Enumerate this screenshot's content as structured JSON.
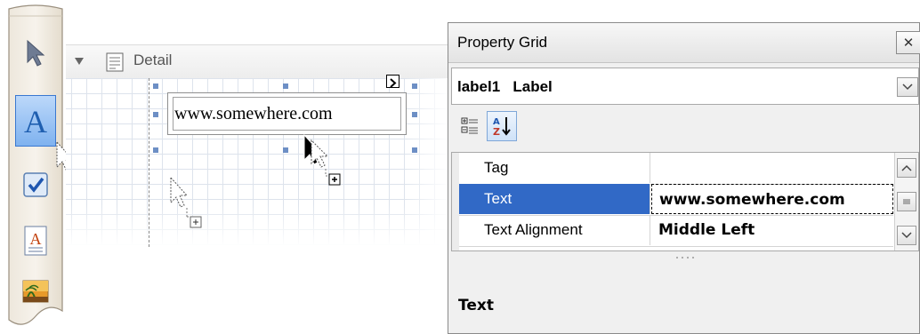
{
  "designer": {
    "band_title": "Detail",
    "label_text": "www.somewhere.com"
  },
  "toolbox": {
    "tools": [
      {
        "icon": "pointer-icon"
      },
      {
        "icon": "label-icon"
      },
      {
        "icon": "checkbox-icon"
      },
      {
        "icon": "rich-text-icon"
      },
      {
        "icon": "picture-box-icon"
      }
    ]
  },
  "property_grid": {
    "title": "Property Grid",
    "selected_object": "label1   Label",
    "toolbar": [
      "categorized-icon",
      "alphabetical-icon"
    ],
    "rows": [
      {
        "name": "Tag",
        "value": ""
      },
      {
        "name": "Text",
        "value": "www.somewhere.com"
      },
      {
        "name": "Text Alignment",
        "value": "Middle Left"
      }
    ],
    "description_title": "Text"
  },
  "colors": {
    "selection": "#3169c6",
    "handle": "#6d8fc5",
    "active_tool": "#4a8fe3"
  }
}
